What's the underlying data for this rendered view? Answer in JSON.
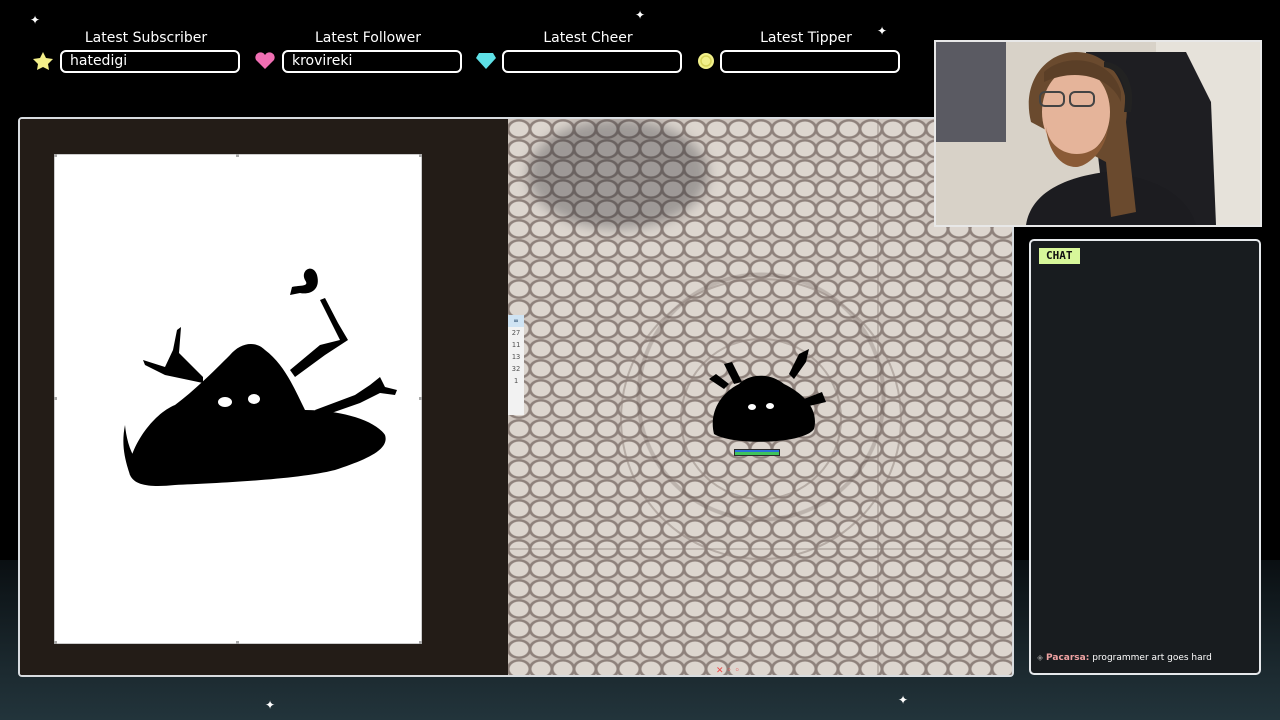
{
  "alerts": [
    {
      "title": "Latest Subscriber",
      "value": "hatedigi",
      "icon": "star-icon",
      "color": "#f3ef8a"
    },
    {
      "title": "Latest Follower",
      "value": "krovireki",
      "icon": "heart-icon",
      "color": "#f06fb3"
    },
    {
      "title": "Latest Cheer",
      "value": "",
      "icon": "gem-icon",
      "color": "#5ee0e6"
    },
    {
      "title": "Latest Tipper",
      "value": "",
      "icon": "coin-icon",
      "color": "#f1f08a"
    }
  ],
  "game": {
    "mini_list_header": "∞",
    "mini_list_values": [
      "27",
      "11",
      "13",
      "32",
      "1"
    ],
    "health_fraction": 1.0
  },
  "chat": {
    "tab_label": "CHAT",
    "messages": [
      {
        "user": "Pacarsa:",
        "text": "programmer art goes hard"
      }
    ]
  },
  "colors": {
    "frame_border": "#d8dce0",
    "chat_tab_bg": "#d7f79a",
    "chat_username": "#f0a3a3"
  }
}
